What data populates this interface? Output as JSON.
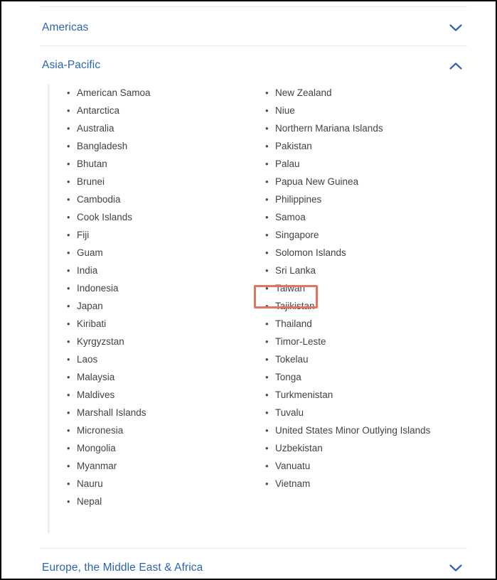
{
  "accordion": {
    "sections": [
      {
        "id": "americas",
        "label": "Americas",
        "expanded": false,
        "icon": "chevron-down-icon"
      },
      {
        "id": "asia-pacific",
        "label": "Asia-Pacific",
        "expanded": true,
        "icon": "chevron-up-icon"
      },
      {
        "id": "emea",
        "label": "Europe, the Middle East & Africa",
        "expanded": false,
        "icon": "chevron-down-icon"
      }
    ]
  },
  "asia_pacific": {
    "left_column": [
      "American Samoa",
      "Antarctica",
      "Australia",
      "Bangladesh",
      "Bhutan",
      "Brunei",
      "Cambodia",
      "Cook Islands",
      "Fiji",
      "Guam",
      "India",
      "Indonesia",
      "Japan",
      "Kiribati",
      "Kyrgyzstan",
      "Laos",
      "Malaysia",
      "Maldives",
      "Marshall Islands",
      "Micronesia",
      "Mongolia",
      "Myanmar",
      "Nauru",
      "Nepal"
    ],
    "right_column": [
      "New Zealand",
      "Niue",
      "Northern Mariana Islands",
      "Pakistan",
      "Palau",
      "Papua New Guinea",
      "Philippines",
      "Samoa",
      "Singapore",
      "Solomon Islands",
      "Sri Lanka",
      "Taiwan",
      "Tajikistan",
      "Thailand",
      "Timor-Leste",
      "Tokelau",
      "Tonga",
      "Turkmenistan",
      "Tuvalu",
      "United States Minor Outlying Islands",
      "Uzbekistan",
      "Vanuatu",
      "Vietnam"
    ]
  },
  "annotation": {
    "highlighted_item": "Taiwan",
    "box_color": "#e5735f"
  },
  "colors": {
    "link": "#2b64b4",
    "text": "#3f4347",
    "divider": "#e4e6e8",
    "panel_rule": "#eceef0",
    "page_border": "#000000"
  }
}
